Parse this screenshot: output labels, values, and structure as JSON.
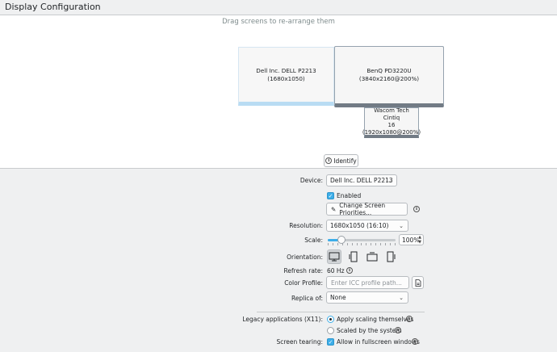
{
  "window": {
    "title": "Display Configuration"
  },
  "arranger": {
    "hint": "Drag screens to re-arrange them",
    "screens": [
      {
        "name": "Dell Inc. DELL P2213",
        "mode": "(1680x1050)"
      },
      {
        "name": "BenQ PD3220U",
        "mode": "(3840x2160@200%)"
      },
      {
        "name_line1": "Wacom Tech Cintiq",
        "name_line2": "16",
        "mode": "(1920x1080@200%)"
      }
    ],
    "identify_label": "Identify"
  },
  "settings": {
    "device_label": "Device:",
    "device_value": "Dell Inc. DELL P2213",
    "enabled_label": "Enabled",
    "priorities_label": "Change Screen Priorities...",
    "resolution_label": "Resolution:",
    "resolution_value": "1680x1050 (16:10)",
    "scale_label": "Scale:",
    "scale_value": "100%",
    "scale_level_percent": 100,
    "orientation_label": "Orientation:",
    "refresh_label": "Refresh rate:",
    "refresh_value": "60 Hz",
    "color_profile_label": "Color Profile:",
    "color_profile_placeholder": "Enter ICC profile path...",
    "replica_label": "Replica of:",
    "replica_value": "None",
    "legacy_label": "Legacy applications (X11):",
    "legacy_option1": "Apply scaling themselves",
    "legacy_option2": "Scaled by the system",
    "tearing_label": "Screen tearing:",
    "tearing_option": "Allow in fullscreen windows"
  },
  "icons": [
    "info-icon",
    "pencil-icon",
    "chevron-down-icon",
    "file-open-icon",
    "monitor-icon",
    "portrait-icon",
    "landscape-flipped-icon",
    "portrait-flipped-icon"
  ],
  "colors": {
    "accent": "#3daee9",
    "background": "#eff0f1",
    "panel": "#ffffff"
  }
}
